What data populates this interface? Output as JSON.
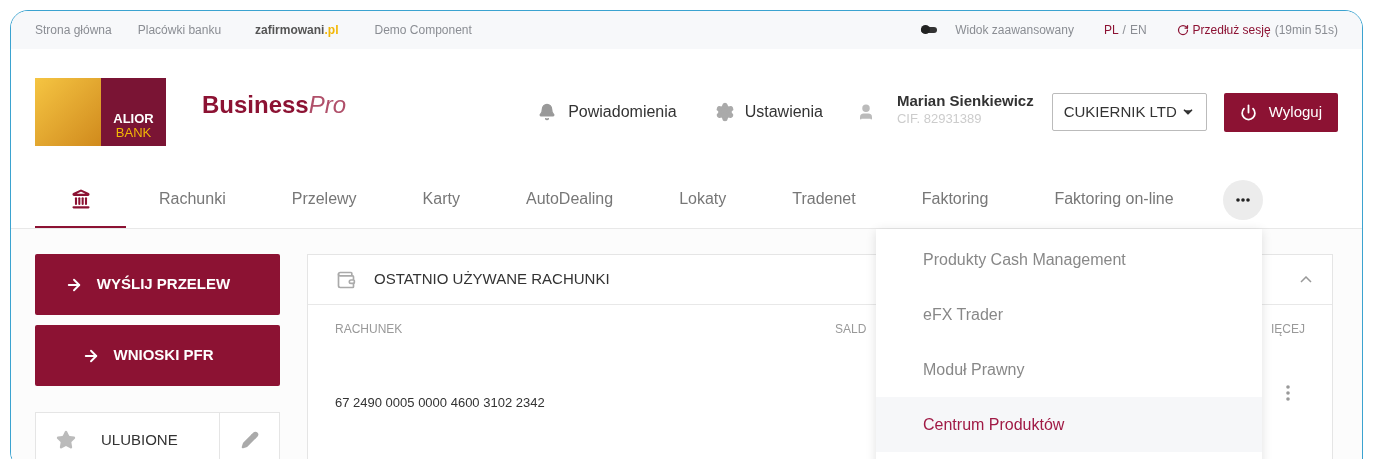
{
  "top_bar": {
    "links": [
      {
        "label": "Strona główna",
        "kind": "plain"
      },
      {
        "label": "Placówki banku",
        "kind": "plain"
      },
      {
        "label": "zafirmowani",
        "suffix": ".pl",
        "kind": "brand"
      },
      {
        "label": "Demo Component",
        "kind": "plain"
      }
    ],
    "advanced_view": {
      "label": "Widok zaawansowany",
      "on": false
    },
    "language": {
      "options": [
        {
          "label": "PL",
          "selected": true
        },
        {
          "label": "EN",
          "selected": false
        }
      ],
      "separator": "/"
    },
    "session": {
      "label": "Przedłuż sesję",
      "time": "(19min 51s)"
    }
  },
  "header": {
    "logo": {
      "line_1": "ALIOR",
      "line_2": "BANK"
    },
    "product": {
      "main": "Business",
      "accent": "Pro"
    },
    "notifications": "Powiadomienia",
    "settings": "Ustawienia",
    "user": {
      "name": "Marian Sienkiewicz",
      "cif": "CIF. 82931389"
    },
    "company": "CUKIERNIK LTD",
    "logout": "Wyloguj"
  },
  "tabs": [
    {
      "kind": "icon",
      "selected": true
    },
    {
      "label": "Rachunki",
      "selected": false
    },
    {
      "label": "Przelewy",
      "selected": false
    },
    {
      "label": "Karty",
      "selected": false
    },
    {
      "label": "AutoDealing",
      "selected": false
    },
    {
      "label": "Lokaty",
      "selected": false
    },
    {
      "label": "Tradenet",
      "selected": false
    },
    {
      "label": "Faktoring",
      "selected": false
    },
    {
      "label": "Faktoring on-line",
      "selected": false
    },
    {
      "kind": "more",
      "selected": false
    }
  ],
  "more_menu": [
    {
      "label": "Produkty Cash Management",
      "selected": false
    },
    {
      "label": "eFX Trader",
      "selected": false
    },
    {
      "label": "Moduł Prawny",
      "selected": false
    },
    {
      "label": "Centrum Produktów",
      "selected": true
    }
  ],
  "sidebar": {
    "actions": [
      "WYŚLIJ PRZELEW",
      "WNIOSKI PFR"
    ],
    "favorites": "ULUBIONE"
  },
  "recent_accounts": {
    "title": "OSTATNIO UŻYWANE RACHUNKI",
    "expanded": true,
    "columns": [
      "RACHUNEK",
      "SALD",
      "IĘCEJ"
    ],
    "rows": [
      {
        "account": "67 2490 0005 0000 4600 3102 2342"
      }
    ]
  }
}
